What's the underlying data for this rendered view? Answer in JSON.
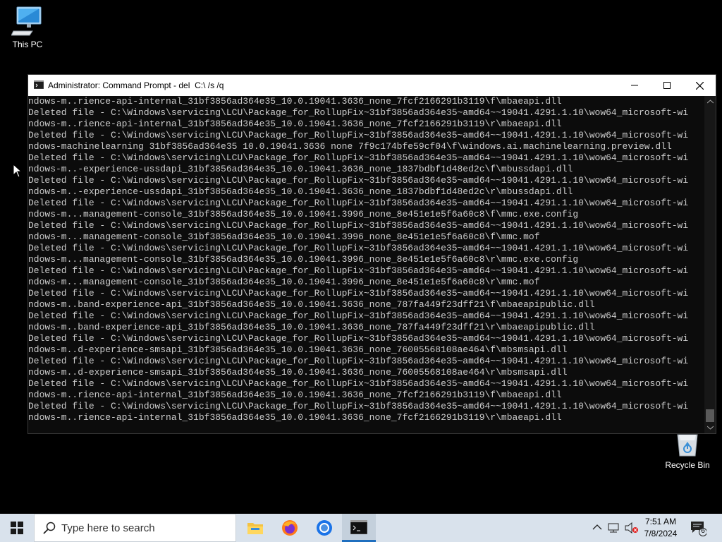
{
  "desktop": {
    "this_pc_label": "This PC",
    "recycle_bin_label": "Recycle Bin"
  },
  "window": {
    "title": "Administrator: Command Prompt - del  C:\\ /s /q",
    "lines": [
      "ndows-m..rience-api-internal_31bf3856ad364e35_10.0.19041.3636_none_7fcf2166291b3119\\f\\mbaeapi.dll",
      "Deleted file - C:\\Windows\\servicing\\LCU\\Package_for_RollupFix~31bf3856ad364e35~amd64~~19041.4291.1.10\\wow64_microsoft-wi",
      "ndows-m..rience-api-internal_31bf3856ad364e35_10.0.19041.3636_none_7fcf2166291b3119\\r\\mbaeapi.dll",
      "Deleted file - C:\\Windows\\servicing\\LCU\\Package_for_RollupFix~31bf3856ad364e35~amd64~~19041.4291.1.10\\wow64_microsoft-wi",
      "ndows-machinelearning 31bf3856ad364e35 10.0.19041.3636 none 7f9c174bfe59cf04\\f\\windows.ai.machinelearning.preview.dll",
      "Deleted file - C:\\Windows\\servicing\\LCU\\Package_for_RollupFix~31bf3856ad364e35~amd64~~19041.4291.1.10\\wow64_microsoft-wi",
      "ndows-m..-experience-ussdapi_31bf3856ad364e35_10.0.19041.3636_none_1837bdbf1d48ed2c\\f\\mbussdapi.dll",
      "Deleted file - C:\\Windows\\servicing\\LCU\\Package_for_RollupFix~31bf3856ad364e35~amd64~~19041.4291.1.10\\wow64_microsoft-wi",
      "ndows-m..-experience-ussdapi_31bf3856ad364e35_10.0.19041.3636_none_1837bdbf1d48ed2c\\r\\mbussdapi.dll",
      "Deleted file - C:\\Windows\\servicing\\LCU\\Package_for_RollupFix~31bf3856ad364e35~amd64~~19041.4291.1.10\\wow64_microsoft-wi",
      "ndows-m...management-console_31bf3856ad364e35_10.0.19041.3996_none_8e451e1e5f6a60c8\\f\\mmc.exe.config",
      "Deleted file - C:\\Windows\\servicing\\LCU\\Package_for_RollupFix~31bf3856ad364e35~amd64~~19041.4291.1.10\\wow64_microsoft-wi",
      "ndows-m...management-console_31bf3856ad364e35_10.0.19041.3996_none_8e451e1e5f6a60c8\\f\\mmc.mof",
      "Deleted file - C:\\Windows\\servicing\\LCU\\Package_for_RollupFix~31bf3856ad364e35~amd64~~19041.4291.1.10\\wow64_microsoft-wi",
      "ndows-m...management-console_31bf3856ad364e35_10.0.19041.3996_none_8e451e1e5f6a60c8\\r\\mmc.exe.config",
      "Deleted file - C:\\Windows\\servicing\\LCU\\Package_for_RollupFix~31bf3856ad364e35~amd64~~19041.4291.1.10\\wow64_microsoft-wi",
      "ndows-m...management-console_31bf3856ad364e35_10.0.19041.3996_none_8e451e1e5f6a60c8\\r\\mmc.mof",
      "Deleted file - C:\\Windows\\servicing\\LCU\\Package_for_RollupFix~31bf3856ad364e35~amd64~~19041.4291.1.10\\wow64_microsoft-wi",
      "ndows-m..band-experience-api_31bf3856ad364e35_10.0.19041.3636_none_787fa449f23dff21\\f\\mbaeapipublic.dll",
      "Deleted file - C:\\Windows\\servicing\\LCU\\Package_for_RollupFix~31bf3856ad364e35~amd64~~19041.4291.1.10\\wow64_microsoft-wi",
      "ndows-m..band-experience-api_31bf3856ad364e35_10.0.19041.3636_none_787fa449f23dff21\\r\\mbaeapipublic.dll",
      "Deleted file - C:\\Windows\\servicing\\LCU\\Package_for_RollupFix~31bf3856ad364e35~amd64~~19041.4291.1.10\\wow64_microsoft-wi",
      "ndows-m..d-experience-smsapi_31bf3856ad364e35_10.0.19041.3636_none_76005568108ae464\\f\\mbsmsapi.dll",
      "Deleted file - C:\\Windows\\servicing\\LCU\\Package_for_RollupFix~31bf3856ad364e35~amd64~~19041.4291.1.10\\wow64_microsoft-wi",
      "ndows-m..d-experience-smsapi_31bf3856ad364e35_10.0.19041.3636_none_76005568108ae464\\r\\mbsmsapi.dll",
      "Deleted file - C:\\Windows\\servicing\\LCU\\Package_for_RollupFix~31bf3856ad364e35~amd64~~19041.4291.1.10\\wow64_microsoft-wi",
      "ndows-m..rience-api-internal_31bf3856ad364e35_10.0.19041.3636_none_7fcf2166291b3119\\f\\mbaeapi.dll",
      "Deleted file - C:\\Windows\\servicing\\LCU\\Package_for_RollupFix~31bf3856ad364e35~amd64~~19041.4291.1.10\\wow64_microsoft-wi",
      "ndows-m..rience-api-internal_31bf3856ad364e35_10.0.19041.3636_none_7fcf2166291b3119\\r\\mbaeapi.dll"
    ]
  },
  "taskbar": {
    "search_placeholder": "Type here to search",
    "apps": [
      "file-explorer",
      "firefox",
      "chrome",
      "command-prompt"
    ],
    "time": "7:51 AM",
    "date": "7/8/2024",
    "notification_count": "6"
  },
  "colors": {
    "console_bg": "#0c0c0c",
    "console_text": "#cccccc",
    "taskbar_bg": "#d9e2ec",
    "accent": "#1f6fbf"
  }
}
